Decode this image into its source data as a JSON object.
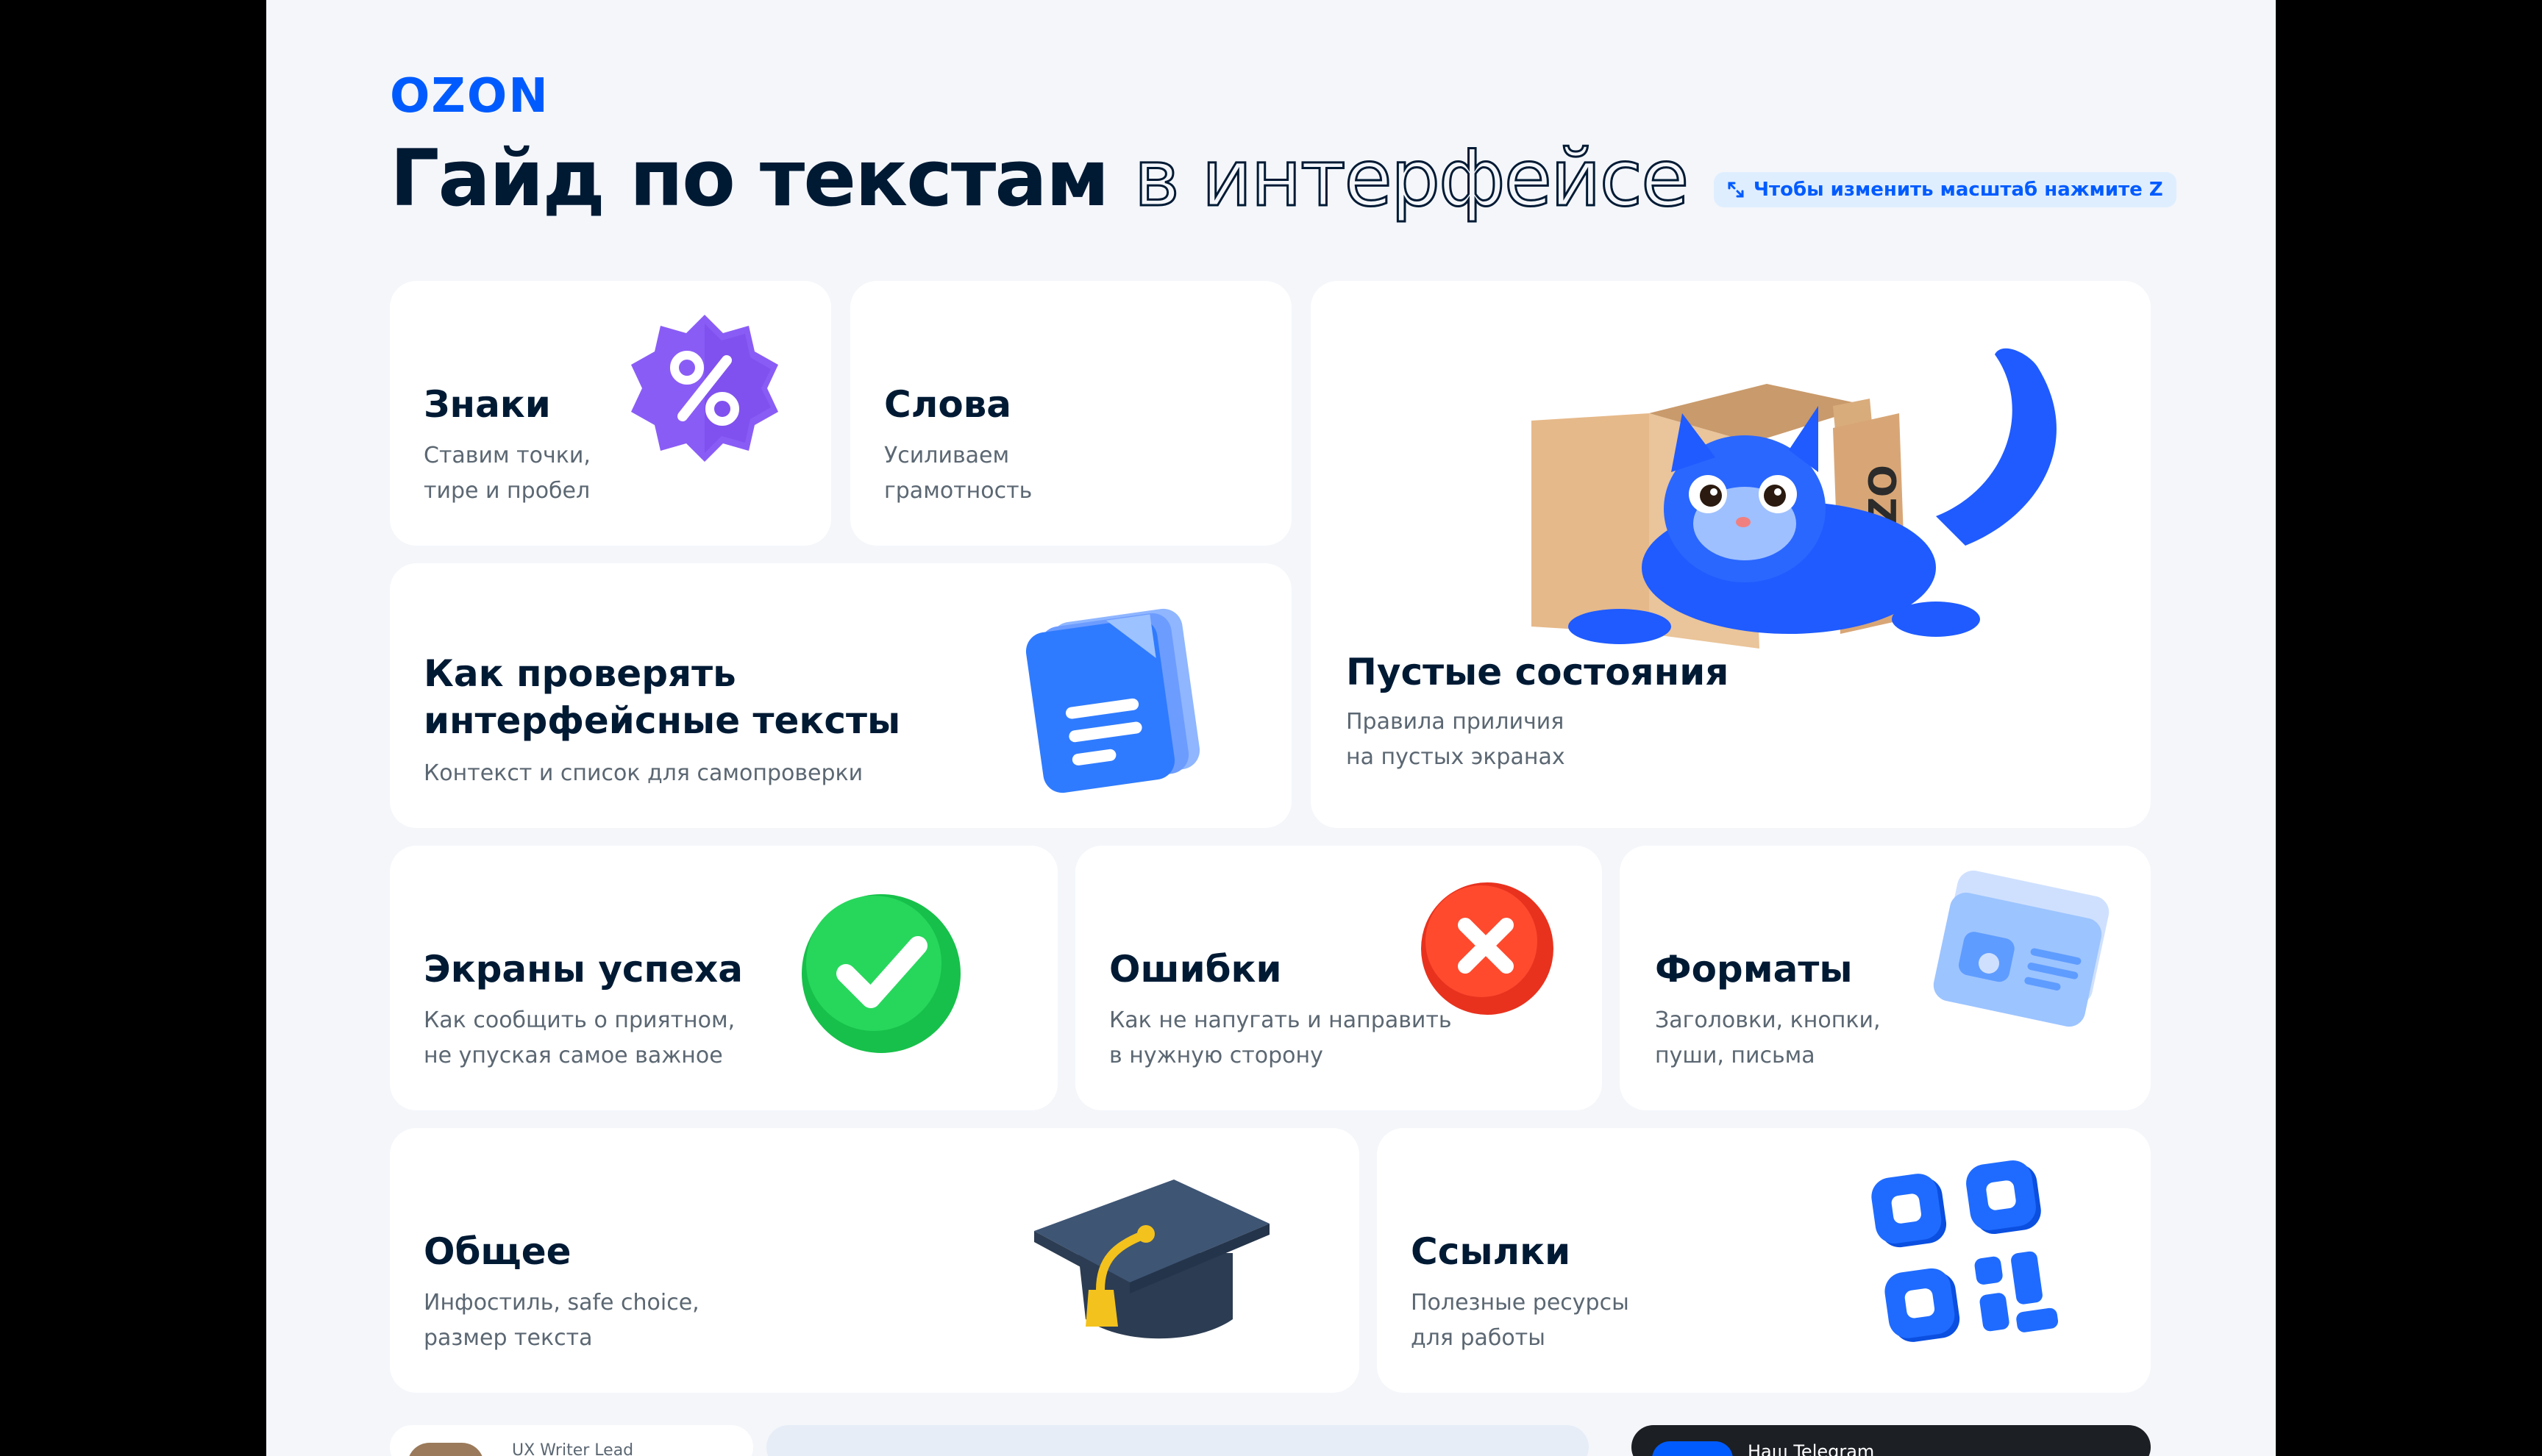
{
  "brand": {
    "logo_text": "OZON",
    "accent": "#005bff"
  },
  "header": {
    "title_bold": "Гайд по текстам",
    "title_outline": "в интерфейсе",
    "zoom_hint": "Чтобы изменить масштаб нажмите Z"
  },
  "cards": {
    "signs": {
      "title": "Знаки",
      "line1": "Ставим точки,",
      "line2": "тире и пробел"
    },
    "words": {
      "title": "Слова",
      "line1": "Усиливаем",
      "line2": "грамотность"
    },
    "check": {
      "title1": "Как проверять",
      "title2": "интерфейсные тексты",
      "line1": "Контекст и список для самопроверки"
    },
    "empty": {
      "title": "Пустые состояния",
      "line1": "Правила приличия",
      "line2": "на пустых экранах"
    },
    "success": {
      "title": "Экраны успеха",
      "line1": "Как сообщить о приятном,",
      "line2": "не упуская самое важное"
    },
    "errors": {
      "title": "Ошибки",
      "line1": "Как не напугать и направить",
      "line2": "в нужную сторону"
    },
    "formats": {
      "title": "Форматы",
      "line1": "Заголовки, кнопки,",
      "line2": "пуши, письма"
    },
    "general": {
      "title": "Общее",
      "line1": "Инфостиль, safe choice,",
      "line2": "размер текста"
    },
    "links": {
      "title": "Ссылки",
      "line1": "Полезные ресурсы",
      "line2": "для работы"
    }
  },
  "bottom": {
    "author_role": "UX Writer Lead",
    "telegram_label": "Наш Telegram"
  },
  "icons": {
    "percent": "percent-badge-icon",
    "document": "document-icon",
    "cat_box": "cat-in-box-illustration",
    "check": "check-circle-icon",
    "error": "error-x-icon",
    "formats": "photo-card-icon",
    "graduation": "graduation-cap-icon",
    "qr": "qr-code-icon",
    "expand": "expand-icon"
  }
}
